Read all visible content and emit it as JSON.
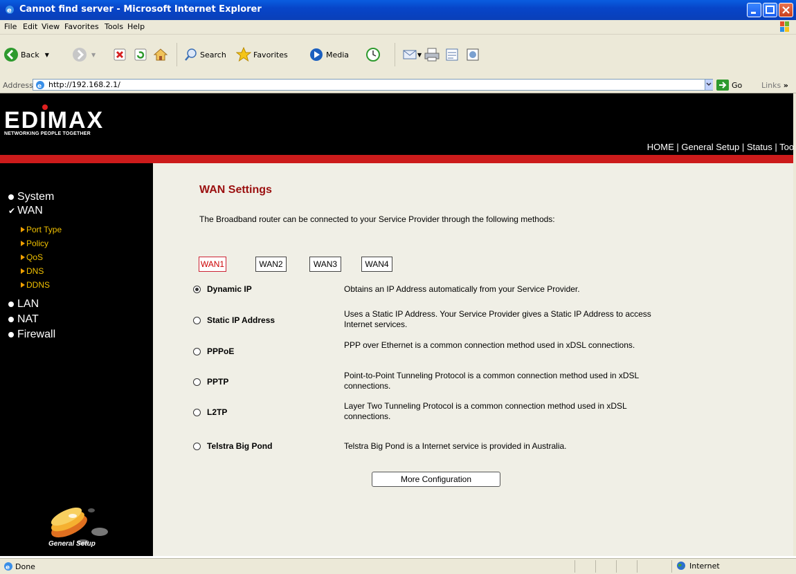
{
  "window": {
    "title": "Cannot find server - Microsoft Internet Explorer"
  },
  "menu": [
    "File",
    "Edit",
    "View",
    "Favorites",
    "Tools",
    "Help"
  ],
  "toolbar": {
    "back": "Back",
    "search": "Search",
    "favorites": "Favorites",
    "media": "Media"
  },
  "address": {
    "label": "Address",
    "url": "http://192.168.2.1/",
    "go": "Go",
    "links": "Links"
  },
  "header": {
    "logo_text": "EDIMAX",
    "tagline": "NETWORKING PEOPLE TOGETHER",
    "nav": [
      "HOME",
      "General Setup",
      "Status",
      "Tool"
    ],
    "sep": "|"
  },
  "sidebar": {
    "items": [
      {
        "label": "System"
      },
      {
        "label": "WAN"
      },
      {
        "label": "LAN"
      },
      {
        "label": "NAT"
      },
      {
        "label": "Firewall"
      }
    ],
    "subitems": [
      "Port Type",
      "Policy",
      "QoS",
      "DNS",
      "DDNS"
    ],
    "footer_label": "General Setup"
  },
  "content": {
    "title": "WAN Settings",
    "description": "The Broadband router can be connected to your Service Provider through the following methods:",
    "tabs": [
      "WAN1",
      "WAN2",
      "WAN3",
      "WAN4"
    ],
    "active_tab": "WAN1",
    "options": [
      {
        "name": "Dynamic IP",
        "desc": "Obtains an IP Address automatically from your Service Provider.",
        "selected": true
      },
      {
        "name": "Static IP Address",
        "desc": "Uses a Static IP Address. Your Service Provider gives a Static IP Address to access Internet services.",
        "selected": false
      },
      {
        "name": "PPPoE",
        "desc": "PPP over Ethernet is a common connection method used in xDSL connections.",
        "selected": false
      },
      {
        "name": "PPTP",
        "desc": "Point-to-Point Tunneling Protocol is a common connection method used in xDSL connections.",
        "selected": false
      },
      {
        "name": "L2TP",
        "desc": "Layer Two Tunneling Protocol is a common connection method used in xDSL connections.",
        "selected": false
      },
      {
        "name": "Telstra Big Pond",
        "desc": "Telstra Big Pond is a Internet service is provided in Australia.",
        "selected": false
      }
    ],
    "more_button": "More Configuration"
  },
  "status": {
    "text": "Done",
    "zone": "Internet"
  },
  "colors": {
    "accent_red": "#cc1b1b",
    "title_red": "#9b1010",
    "sub_yellow": "#f0c000"
  }
}
